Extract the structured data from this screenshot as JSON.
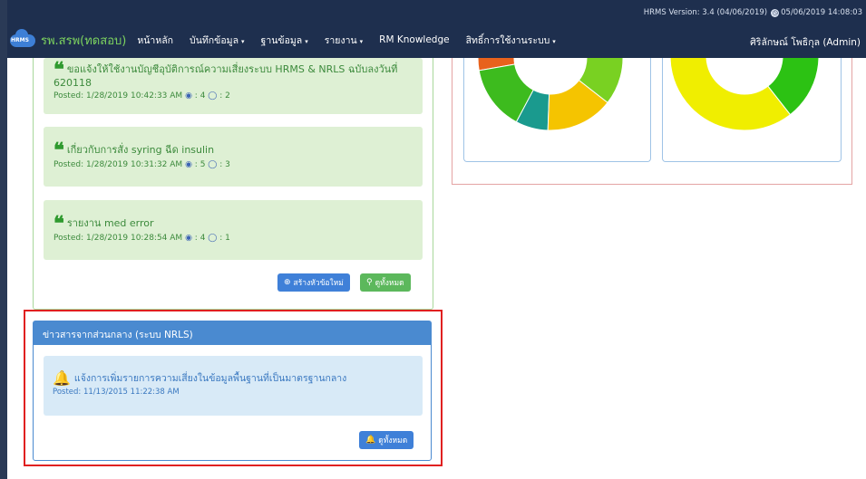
{
  "header": {
    "version_text": "HRMS Version: 3.4 (04/06/2019)",
    "datetime_text": "05/06/2019 14:08:03",
    "logo_text": "HRMS",
    "brand": "รพ.สรพ(ทดสอบ)",
    "nav": [
      {
        "label": "หน้าหลัก",
        "dropdown": false
      },
      {
        "label": "บันทึกข้อมูล",
        "dropdown": true
      },
      {
        "label": "ฐานข้อมูล",
        "dropdown": true
      },
      {
        "label": "รายงาน",
        "dropdown": true
      },
      {
        "label": "RM Knowledge",
        "dropdown": false
      },
      {
        "label": "สิทธิ์การใช้งานระบบ",
        "dropdown": true
      }
    ],
    "user": "ศิริลักษณ์ โพธิกุล (Admin)"
  },
  "news_panel": {
    "posts": [
      {
        "title": "ขอแจ้งให้ใช้งานบัญชีอุบัติการณ์ความเสี่ยงระบบ HRMS & NRLS ฉบับลงวันที่ 620118",
        "posted": "Posted: 1/28/2019 10:42:33 AM",
        "views": "4",
        "comments": "2"
      },
      {
        "title": "เกี่ยวกับการสั่ง syring ฉีด insulin",
        "posted": "Posted: 1/28/2019 10:31:32 AM",
        "views": "5",
        "comments": "3"
      },
      {
        "title": "รายงาน med error",
        "posted": "Posted: 1/28/2019 10:28:54 AM",
        "views": "4",
        "comments": "1"
      }
    ],
    "create_button": "สร้างหัวข้อใหม่",
    "view_all_button": "ดูทั้งหมด"
  },
  "central_news": {
    "heading": "ข่าวสารจากส่วนกลาง (ระบบ NRLS)",
    "item": {
      "title": "แจ้งการเพิ่มรายการความเสี่ยงในข้อมูลพื้นฐานที่เป็นมาตรฐานกลาง",
      "posted": "Posted: 11/13/2015 11:22:38 AM"
    },
    "view_all_button": "ดูทั้งหมด"
  },
  "colors": {
    "nav_bg": "#1e2f4e",
    "brand": "#7dd35f",
    "highlight_outline": "#e02020",
    "green_panel": "#def0d4",
    "blue_panel": "#d8eaf7"
  },
  "chart_data": [
    {
      "type": "pie",
      "title": "",
      "donut": true,
      "visible_portion": "bottom part only",
      "slices": [
        {
          "color": "#e8621c"
        },
        {
          "color": "#3dbb1e"
        },
        {
          "color": "#1a9a8e"
        },
        {
          "color": "#f5c400"
        },
        {
          "color": "#79d122"
        }
      ]
    },
    {
      "type": "pie",
      "title": "",
      "donut": true,
      "visible_portion": "bottom part only",
      "slices": [
        {
          "color": "#f0ee00"
        },
        {
          "color": "#2cc213"
        }
      ]
    }
  ]
}
